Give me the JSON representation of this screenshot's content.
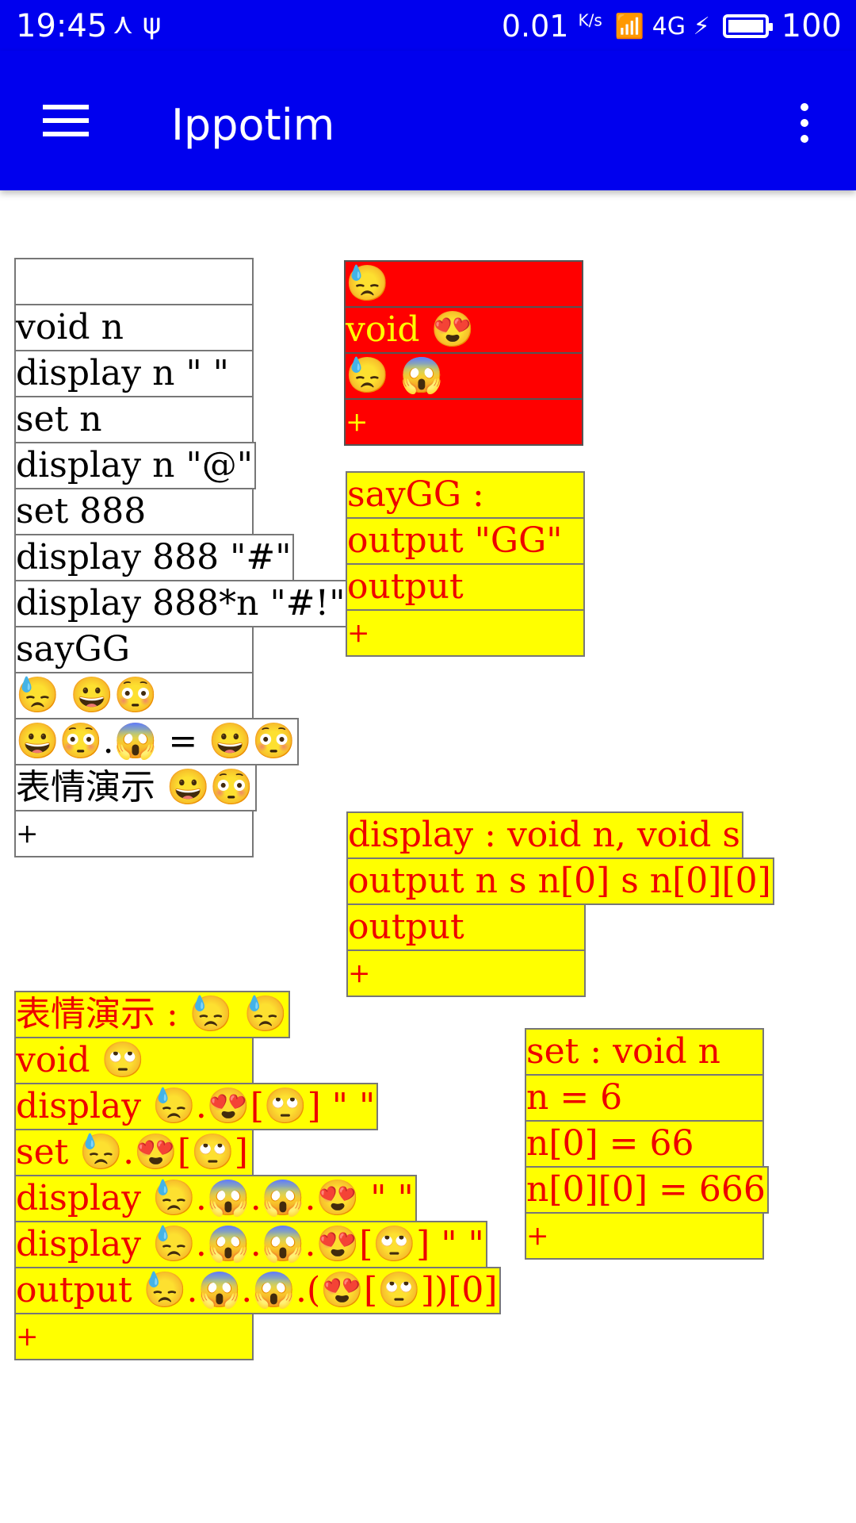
{
  "status_bar": {
    "time": "19:45",
    "left_icons": "⋏ ψ",
    "net_speed": "0.01",
    "net_unit": "K/s",
    "right_icons": "📶 4G ⚡",
    "battery": "100"
  },
  "app_bar": {
    "title": "Ippotim"
  },
  "blocks": {
    "main": [
      "",
      "void n",
      "display n \" \"",
      "set n",
      "display n \"@\"",
      "set 888",
      "display 888 \"#\"",
      "display 888*n \"#!\"",
      "sayGG",
      "😓 😀😳",
      "😀😳.😱 = 😀😳",
      "表情演示 😀😳",
      "+"
    ],
    "red": [
      "😓",
      "void 😍",
      "😓 😱",
      "+"
    ],
    "saygg": [
      "sayGG :",
      "output \"GG\"",
      "output",
      "+"
    ],
    "display_def": [
      "display : void n, void s",
      "output n s n[0] s n[0][0]",
      "output",
      "+"
    ],
    "emoji_demo": [
      "表情演示 : 😓 😓",
      "void 🙄",
      "display 😓.😍[🙄] \" \"",
      "set 😓.😍[🙄]",
      "display 😓.😱.😱.😍 \" \"",
      "display 😓.😱.😱.😍[🙄] \" \"",
      "output 😓.😱.😱.(😍[🙄])[0]",
      "+"
    ],
    "set_def": [
      "set : void n",
      "n = 6",
      "n[0] = 66",
      "n[0][0] = 666",
      "+"
    ]
  }
}
